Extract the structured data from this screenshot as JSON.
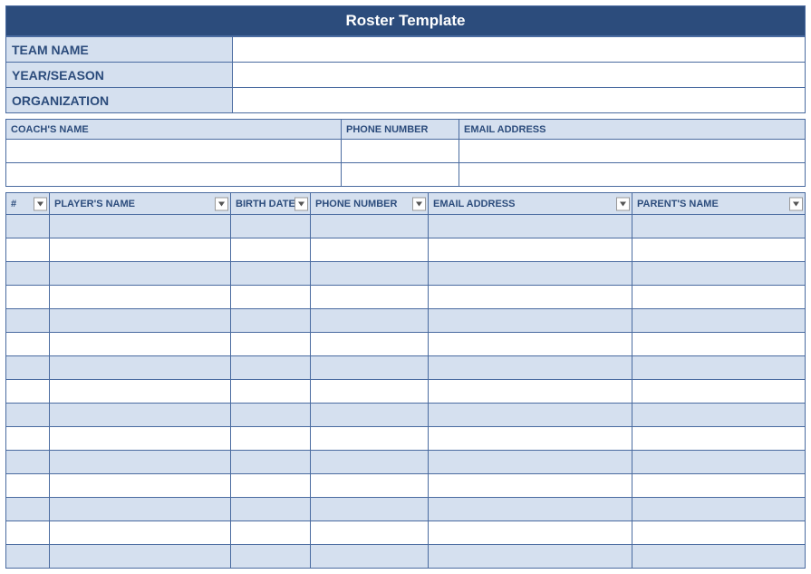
{
  "title": "Roster Template",
  "info_fields": [
    {
      "label": "TEAM NAME",
      "value": ""
    },
    {
      "label": "YEAR/SEASON",
      "value": ""
    },
    {
      "label": "ORGANIZATION",
      "value": ""
    }
  ],
  "coach_headers": [
    "COACH'S NAME",
    "PHONE NUMBER",
    "EMAIL ADDRESS"
  ],
  "coach_rows": [
    {
      "name": "",
      "phone": "",
      "email": ""
    },
    {
      "name": "",
      "phone": "",
      "email": ""
    }
  ],
  "player_headers": [
    "#",
    "PLAYER'S NAME",
    "BIRTH DATE",
    "PHONE NUMBER",
    "EMAIL ADDRESS",
    "PARENT'S NAME"
  ],
  "player_rows": [
    {
      "num": "",
      "name": "",
      "birth": "",
      "phone": "",
      "email": "",
      "parent": ""
    },
    {
      "num": "",
      "name": "",
      "birth": "",
      "phone": "",
      "email": "",
      "parent": ""
    },
    {
      "num": "",
      "name": "",
      "birth": "",
      "phone": "",
      "email": "",
      "parent": ""
    },
    {
      "num": "",
      "name": "",
      "birth": "",
      "phone": "",
      "email": "",
      "parent": ""
    },
    {
      "num": "",
      "name": "",
      "birth": "",
      "phone": "",
      "email": "",
      "parent": ""
    },
    {
      "num": "",
      "name": "",
      "birth": "",
      "phone": "",
      "email": "",
      "parent": ""
    },
    {
      "num": "",
      "name": "",
      "birth": "",
      "phone": "",
      "email": "",
      "parent": ""
    },
    {
      "num": "",
      "name": "",
      "birth": "",
      "phone": "",
      "email": "",
      "parent": ""
    },
    {
      "num": "",
      "name": "",
      "birth": "",
      "phone": "",
      "email": "",
      "parent": ""
    },
    {
      "num": "",
      "name": "",
      "birth": "",
      "phone": "",
      "email": "",
      "parent": ""
    },
    {
      "num": "",
      "name": "",
      "birth": "",
      "phone": "",
      "email": "",
      "parent": ""
    },
    {
      "num": "",
      "name": "",
      "birth": "",
      "phone": "",
      "email": "",
      "parent": ""
    },
    {
      "num": "",
      "name": "",
      "birth": "",
      "phone": "",
      "email": "",
      "parent": ""
    },
    {
      "num": "",
      "name": "",
      "birth": "",
      "phone": "",
      "email": "",
      "parent": ""
    },
    {
      "num": "",
      "name": "",
      "birth": "",
      "phone": "",
      "email": "",
      "parent": ""
    }
  ]
}
